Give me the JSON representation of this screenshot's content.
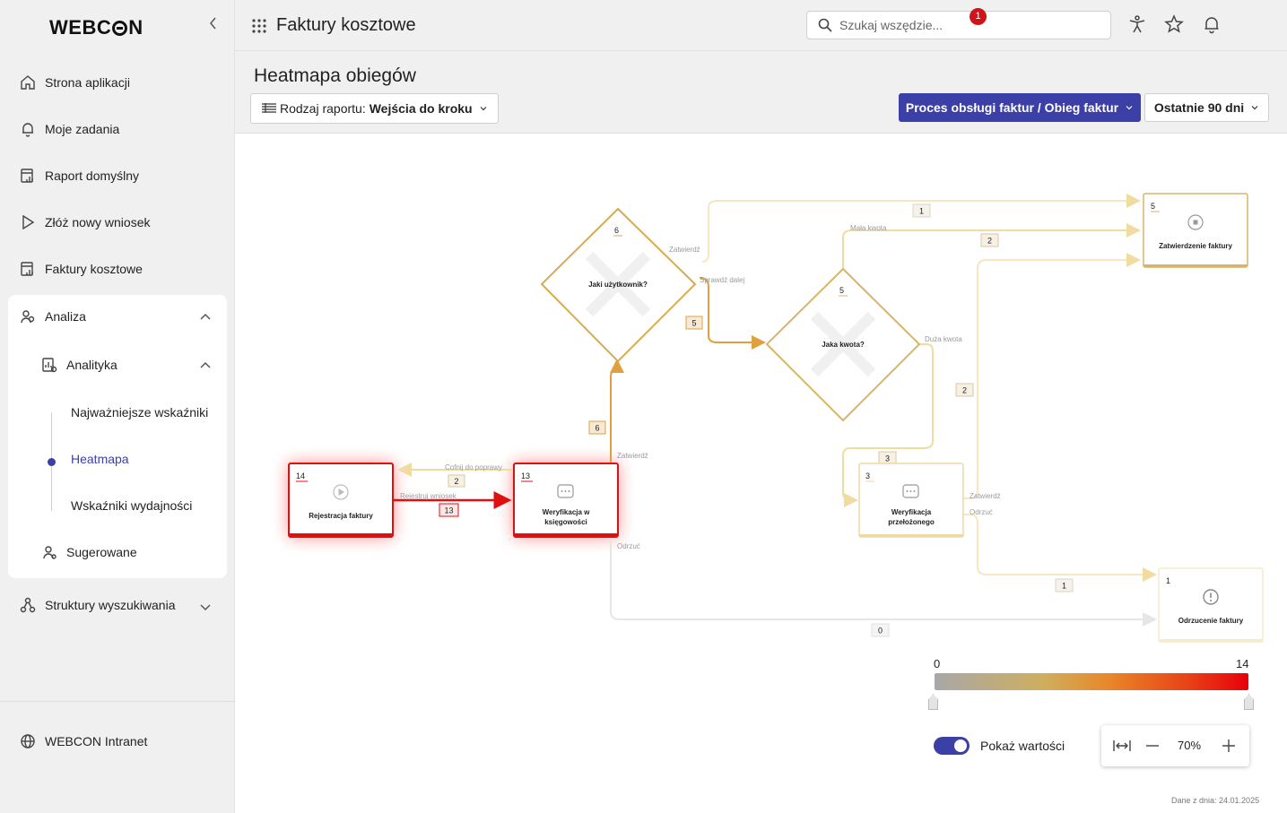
{
  "sidebar": {
    "logo": {
      "pre": "WEBC",
      "post": "N"
    },
    "items": [
      {
        "label": "Strona aplikacji",
        "icon": "home-icon"
      },
      {
        "label": "Moje zadania",
        "icon": "bell-icon"
      },
      {
        "label": "Raport domyślny",
        "icon": "report-icon"
      },
      {
        "label": "Złóż nowy wniosek",
        "icon": "play-icon"
      },
      {
        "label": "Faktury kosztowe",
        "icon": "report-icon"
      }
    ],
    "analiza": {
      "label": "Analiza",
      "analityka": {
        "label": "Analityka",
        "children": [
          "Najważniejsze wskaźniki",
          "Heatmapa",
          "Wskaźniki wydajności"
        ]
      },
      "sugerowane": "Sugerowane"
    },
    "struktury": "Struktury wyszukiwania",
    "intranet": "WEBCON Intranet"
  },
  "topbar": {
    "app_title": "Faktury kosztowe",
    "search_placeholder": "Szukaj wszędzie...",
    "notification_count": "1"
  },
  "header": {
    "title": "Heatmapa obiegów",
    "report_type_label": "Rodzaj raportu:",
    "report_type_value": "Wejścia do kroku",
    "process": "Proces obsługi faktur / Obieg faktur",
    "period": "Ostatnie 90 dni"
  },
  "diagram": {
    "nodes": [
      {
        "title": "Rejestracja faktury",
        "count": "14",
        "icon": "play-circle-icon"
      },
      {
        "title_l1": "Weryfikacja w",
        "title_l2": "księgowości",
        "count": "13",
        "icon": "dots-icon"
      },
      {
        "title": "Jaki użytkownik?",
        "count": "6"
      },
      {
        "title": "Jaka kwota?",
        "count": "5"
      },
      {
        "title_l1": "Weryfikacja",
        "title_l2": "przełożonego",
        "count": "3",
        "icon": "dots-icon"
      },
      {
        "title": "Zatwierdzenie faktury",
        "count": "5",
        "icon": "stop-circle-icon"
      },
      {
        "title": "Odrzucenie faktury",
        "count": "1",
        "icon": "alert-circle-icon"
      }
    ],
    "path_labels": {
      "cofnij": "Cofnij do poprawy",
      "rejestruj": "Rejestruj wniosek",
      "zatwierdz": "Zatwierdź",
      "odrzuc": "Odrzuć",
      "sprawdz": "Sprawdź dalej",
      "mala": "Mała kwota",
      "duza": "Duża kwota"
    },
    "edge_counts": {
      "cofnij": "2",
      "rejestruj": "13",
      "ver_to_user": "6",
      "user_zatw": "1",
      "user_sprawdz": "5",
      "mala": "2",
      "duza": "3",
      "przel_zatw": "2",
      "przel_odrzuc": "1",
      "ver_odrzuc": "0"
    }
  },
  "legend": {
    "min": "0",
    "max": "14"
  },
  "controls": {
    "show_values_label": "Pokaż wartości",
    "zoom": "70%"
  },
  "footer": {
    "data_date": "Dane z dnia: 24.01.2025"
  }
}
